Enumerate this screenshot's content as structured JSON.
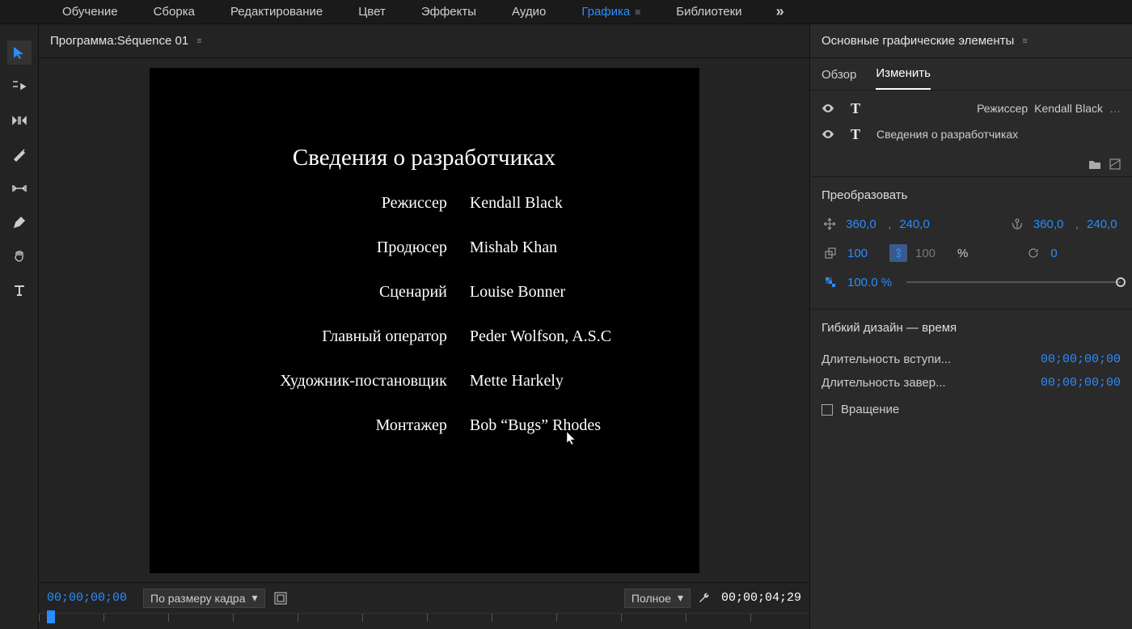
{
  "topTabs": {
    "t0": "Обучение",
    "t1": "Сборка",
    "t2": "Редактирование",
    "t3": "Цвет",
    "t4": "Эффекты",
    "t5": "Аудио",
    "t6": "Графика",
    "t7": "Библиотеки"
  },
  "program": {
    "panelTitlePrefix": "Программа: ",
    "sequenceName": "Séquence 01"
  },
  "video": {
    "title": "Сведения о разработчиках",
    "credits": [
      {
        "role": "Режиссер",
        "name": "Kendall Black"
      },
      {
        "role": "Продюсер",
        "name": "Mishab Khan"
      },
      {
        "role": "Сценарий",
        "name": "Louise Bonner"
      },
      {
        "role": "Главный оператор",
        "name": "Peder Wolfson, A.S.C"
      },
      {
        "role": "Художник-постановщик",
        "name": "Mette Harkely"
      },
      {
        "role": "Монтажер",
        "name": "Bob “Bugs” Rhodes"
      }
    ]
  },
  "footer": {
    "timecodeLeft": "00;00;00;00",
    "fitLabel": "По размеру кадра",
    "qualityLabel": "Полное",
    "timecodeRight": "00;00;04;29"
  },
  "essentialGraphics": {
    "panelTitle": "Основные графические элементы",
    "tabBrowse": "Обзор",
    "tabEdit": "Изменить",
    "layer1Role": "Режиссер",
    "layer1Name": "Kendall Black",
    "layer2Text": "Сведения о разработчиках"
  },
  "transform": {
    "title": "Преобразовать",
    "posX": "360,0",
    "posComma": ",",
    "posY": "240,0",
    "anchorX": "360,0",
    "anchorComma": ",",
    "anchorY": "240,0",
    "scaleW": "100",
    "scaleH": "100",
    "pct": "%",
    "rotation": "0",
    "opacity": "100.0 %"
  },
  "responsive": {
    "title": "Гибкий дизайн — время",
    "introLabel": "Длительность вступи...",
    "introVal": "00;00;00;00",
    "outroLabel": "Длительность завер...",
    "outroVal": "00;00;00;00",
    "rollLabel": "Вращение"
  }
}
